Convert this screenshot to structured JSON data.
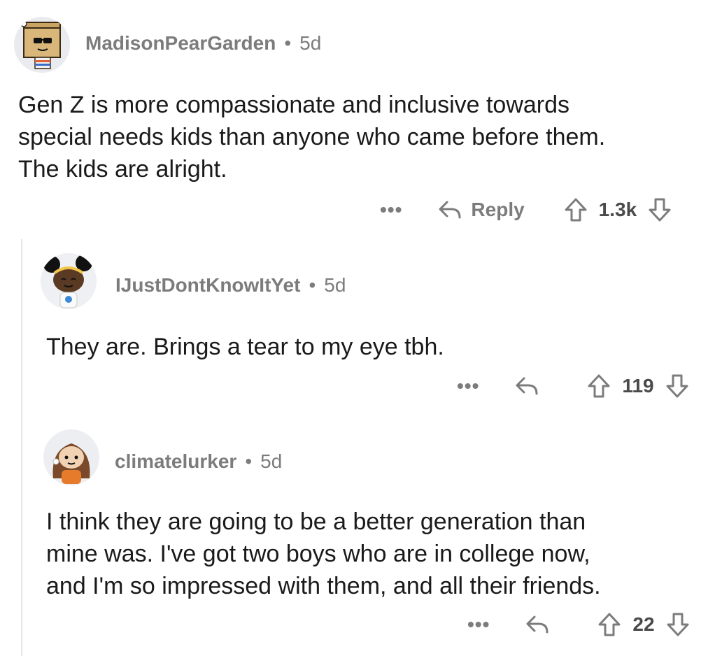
{
  "comments": [
    {
      "user": "MadisonPearGarden",
      "age": "5d",
      "separator": "•",
      "body": "Gen Z is more compassionate and inclusive towards\nspecial needs kids than anyone who came before them.\nThe kids are alright.",
      "more": "•••",
      "reply_label": "Reply",
      "score": "1.3k",
      "avatar_icon": "snoo-avatar-box-sunglasses"
    },
    {
      "user": "IJustDontKnowItYet",
      "age": "5d",
      "separator": "•",
      "body": "They are. Brings a tear to my eye tbh.",
      "more": "•••",
      "score": "119",
      "avatar_icon": "snoo-avatar-afro-puffs"
    },
    {
      "user": "climatelurker",
      "age": "5d",
      "separator": "•",
      "body": "I think they are going to be a better generation than\nmine was.  I've got two boys who are in college now,\nand I'm so impressed with them, and all their friends.",
      "more": "•••",
      "score": "22",
      "avatar_icon": "snoo-avatar-long-hair"
    }
  ],
  "colors": {
    "meta_text": "#7c7c7c",
    "body_text": "#1a1a1b",
    "thread_line": "#e3e5e8"
  }
}
